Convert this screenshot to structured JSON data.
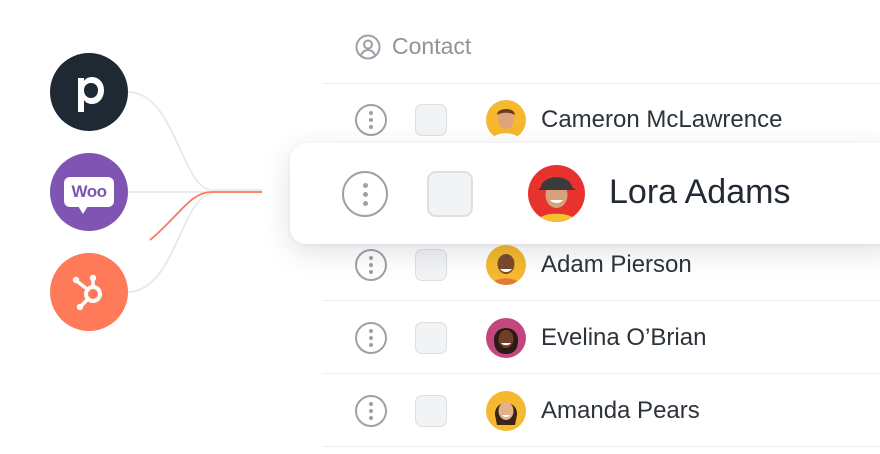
{
  "integrations": [
    {
      "name": "Pipedrive",
      "letter": "p",
      "color": "#1f2933"
    },
    {
      "name": "WooCommerce",
      "letter": "Woo",
      "color": "#7f54b3"
    },
    {
      "name": "HubSpot",
      "letter": "",
      "color": "#ff7a59"
    }
  ],
  "connector_accent_color": "#ff7a59",
  "table": {
    "header_label": "Contact",
    "header_icon": "user-circle-icon",
    "rows": [
      {
        "name": "Cameron McLawrence",
        "avatar_bg": "#f5b82e"
      },
      {
        "name": "Lora Adams",
        "avatar_bg": "#e8322e",
        "highlighted": true
      },
      {
        "name": "Adam Pierson",
        "avatar_bg": "#f5b82e"
      },
      {
        "name": "Evelina O’Brian",
        "avatar_bg": "#c2477f"
      },
      {
        "name": "Amanda Pears",
        "avatar_bg": "#f5b82e"
      }
    ]
  }
}
